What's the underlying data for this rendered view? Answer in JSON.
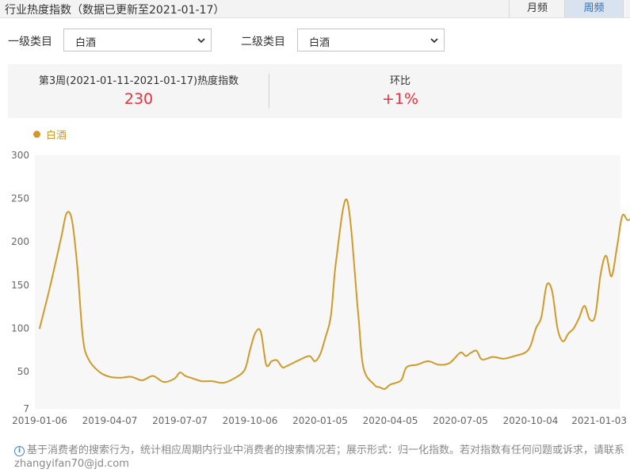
{
  "header": {
    "title": "行业热度指数（数据已更新至2021-01-17）",
    "month_tab": "月频",
    "week_tab": "周频"
  },
  "filters": {
    "level1_label": "一级类目",
    "level1_value": "白酒",
    "level2_label": "二级类目",
    "level2_value": "白酒"
  },
  "stats": {
    "index_label": "第3周(2021-01-11-2021-01-17)热度指数",
    "index_value": "230",
    "ratio_label": "环比",
    "ratio_value": "+1%"
  },
  "colors": {
    "series": "#d09a2a",
    "highlight": "#e5323f",
    "active_tab": "#2f6fb5"
  },
  "chart_data": {
    "type": "line",
    "series": [
      {
        "name": "白酒",
        "points": [
          [
            "2019-01-06",
            100
          ],
          [
            "2019-01-20",
            150
          ],
          [
            "2019-02-03",
            205
          ],
          [
            "2019-02-10",
            233
          ],
          [
            "2019-02-17",
            225
          ],
          [
            "2019-02-24",
            170
          ],
          [
            "2019-03-03",
            90
          ],
          [
            "2019-03-10",
            65
          ],
          [
            "2019-03-24",
            50
          ],
          [
            "2019-04-07",
            44
          ],
          [
            "2019-04-21",
            43
          ],
          [
            "2019-05-05",
            44
          ],
          [
            "2019-05-19",
            40
          ],
          [
            "2019-06-02",
            45
          ],
          [
            "2019-06-16",
            38
          ],
          [
            "2019-06-30",
            42
          ],
          [
            "2019-07-07",
            49
          ],
          [
            "2019-07-14",
            45
          ],
          [
            "2019-07-21",
            43
          ],
          [
            "2019-08-04",
            39
          ],
          [
            "2019-08-18",
            39
          ],
          [
            "2019-09-01",
            37
          ],
          [
            "2019-09-15",
            42
          ],
          [
            "2019-09-29",
            52
          ],
          [
            "2019-10-06",
            75
          ],
          [
            "2019-10-13",
            95
          ],
          [
            "2019-10-20",
            96
          ],
          [
            "2019-10-27",
            58
          ],
          [
            "2019-11-03",
            62
          ],
          [
            "2019-11-10",
            63
          ],
          [
            "2019-11-17",
            55
          ],
          [
            "2019-11-24",
            57
          ],
          [
            "2019-12-08",
            63
          ],
          [
            "2019-12-22",
            68
          ],
          [
            "2019-12-29",
            62
          ],
          [
            "2020-01-05",
            70
          ],
          [
            "2020-01-12",
            90
          ],
          [
            "2020-01-19",
            115
          ],
          [
            "2020-01-26",
            180
          ],
          [
            "2020-02-09",
            248
          ],
          [
            "2020-02-23",
            120
          ],
          [
            "2020-03-01",
            55
          ],
          [
            "2020-03-15",
            35
          ],
          [
            "2020-03-22",
            32
          ],
          [
            "2020-03-29",
            30
          ],
          [
            "2020-04-05",
            35
          ],
          [
            "2020-04-19",
            40
          ],
          [
            "2020-04-26",
            55
          ],
          [
            "2020-05-10",
            58
          ],
          [
            "2020-05-24",
            62
          ],
          [
            "2020-06-07",
            58
          ],
          [
            "2020-06-21",
            60
          ],
          [
            "2020-07-05",
            72
          ],
          [
            "2020-07-12",
            68
          ],
          [
            "2020-07-19",
            72
          ],
          [
            "2020-07-26",
            74
          ],
          [
            "2020-08-02",
            64
          ],
          [
            "2020-08-16",
            67
          ],
          [
            "2020-08-30",
            65
          ],
          [
            "2020-09-13",
            68
          ],
          [
            "2020-09-27",
            72
          ],
          [
            "2020-10-04",
            80
          ],
          [
            "2020-10-11",
            100
          ],
          [
            "2020-10-18",
            113
          ],
          [
            "2020-10-25",
            150
          ],
          [
            "2020-11-01",
            143
          ],
          [
            "2020-11-08",
            100
          ],
          [
            "2020-11-15",
            85
          ],
          [
            "2020-11-22",
            94
          ],
          [
            "2020-11-29",
            100
          ],
          [
            "2020-12-06",
            112
          ],
          [
            "2020-12-13",
            126
          ],
          [
            "2020-12-20",
            110
          ],
          [
            "2020-12-27",
            115
          ],
          [
            "2021-01-03",
            163
          ],
          [
            "2021-01-10",
            184
          ],
          [
            "2021-01-17",
            160
          ],
          [
            "2021-01-24",
            193
          ],
          [
            "2021-01-31",
            230
          ],
          [
            "2021-02-07",
            225
          ],
          [
            "2021-02-14",
            229
          ]
        ]
      }
    ],
    "x_tick_labels": [
      "2019-01-06",
      "2019-04-07",
      "2019-07-07",
      "2019-10-06",
      "2020-01-05",
      "2020-04-05",
      "2020-07-05",
      "2020-10-04",
      "2021-01-03"
    ],
    "y_tick_labels": [
      "7",
      "50",
      "100",
      "150",
      "200",
      "250",
      "300"
    ],
    "ylim": [
      7,
      300
    ],
    "legend_placement": "top-left",
    "grid": false
  },
  "footnote": "基于消费者的搜索行为，统计相应周期内行业中消费者的搜索情况若；展示形式：归一化指数。若对指数有任何问题或诉求，请联系zhangyifan70@jd.com"
}
